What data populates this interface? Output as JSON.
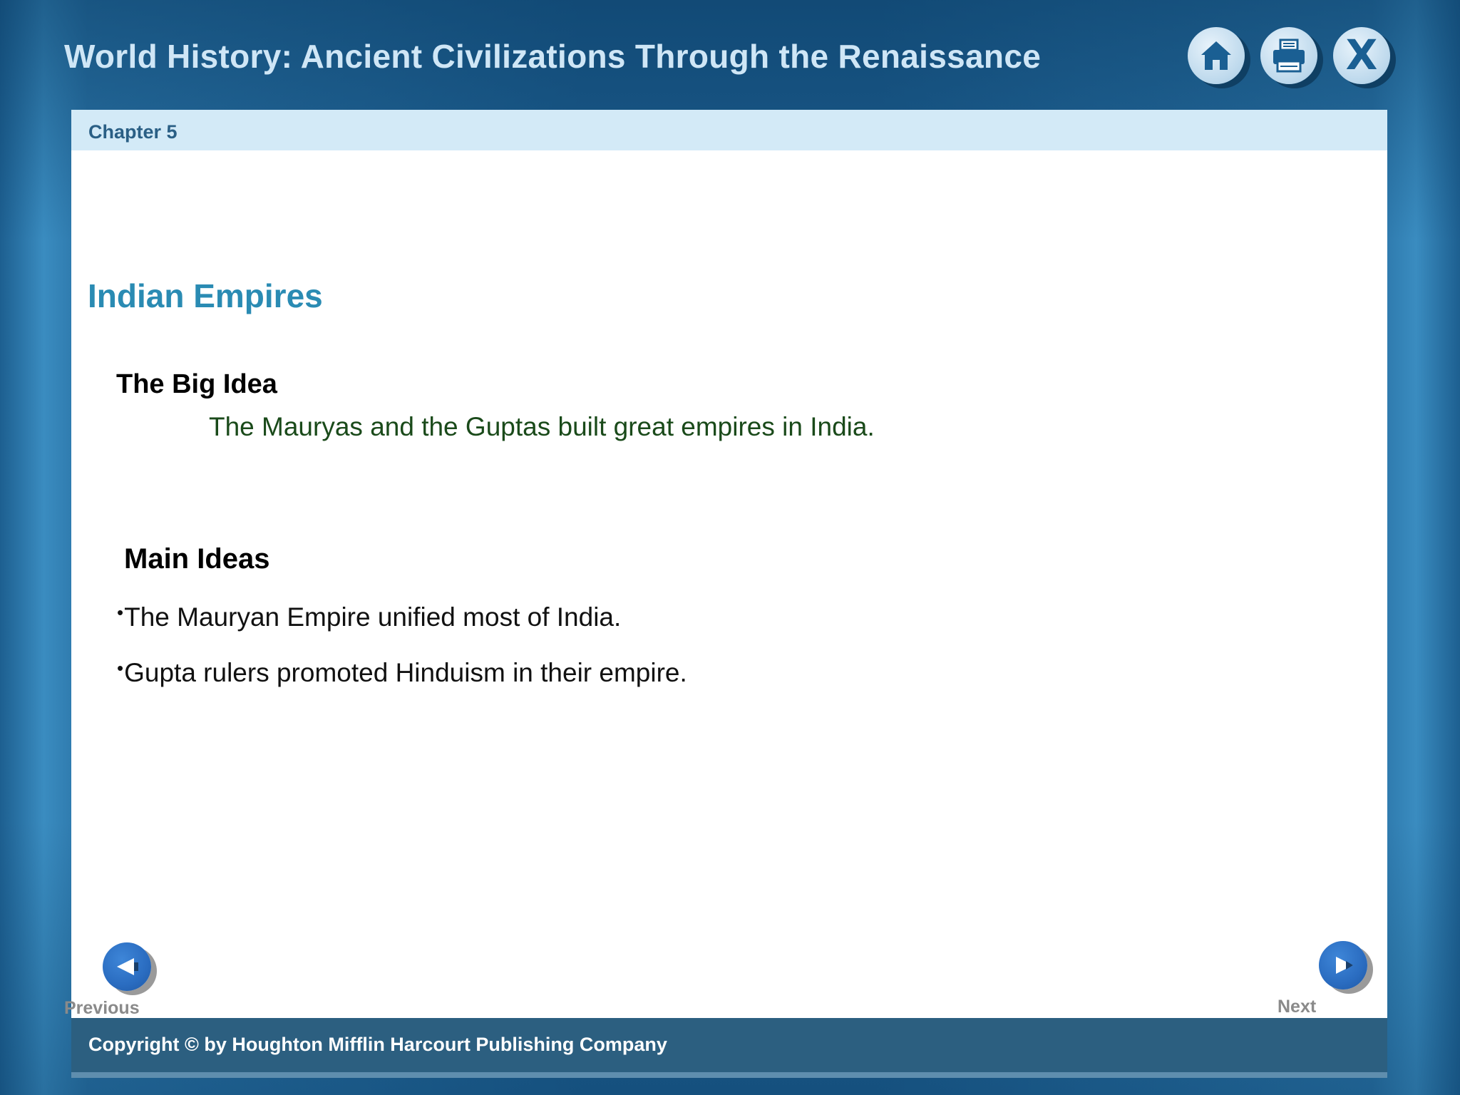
{
  "header": {
    "title": "World History: Ancient Civilizations Through the Renaissance",
    "buttons": {
      "home_icon": "home-icon",
      "print_icon": "printer-icon",
      "close_glyph": "X"
    }
  },
  "chapter": {
    "label": "Chapter 5"
  },
  "content": {
    "section_title": "Indian Empires",
    "big_idea": {
      "heading": "The Big Idea",
      "text": "The Mauryas and the Guptas built great empires in India."
    },
    "main_ideas": {
      "heading": "Main Ideas",
      "bullet_char": "•",
      "items": [
        "The Mauryan Empire unified most of India.",
        "Gupta rulers promoted Hinduism in their empire."
      ]
    }
  },
  "navigation": {
    "previous_label": "Previous",
    "next_label": "Next"
  },
  "footer": {
    "copyright": "Copyright © by Houghton Mifflin Harcourt Publishing Company"
  },
  "colors": {
    "title_text": "#cfe6f6",
    "section_title": "#2a8bb3",
    "big_idea_text": "#1a4a1a",
    "chapter_bar": "#d3eaf7",
    "footer_bar": "#2c5f80",
    "nav_button": "#2a6cc0"
  }
}
